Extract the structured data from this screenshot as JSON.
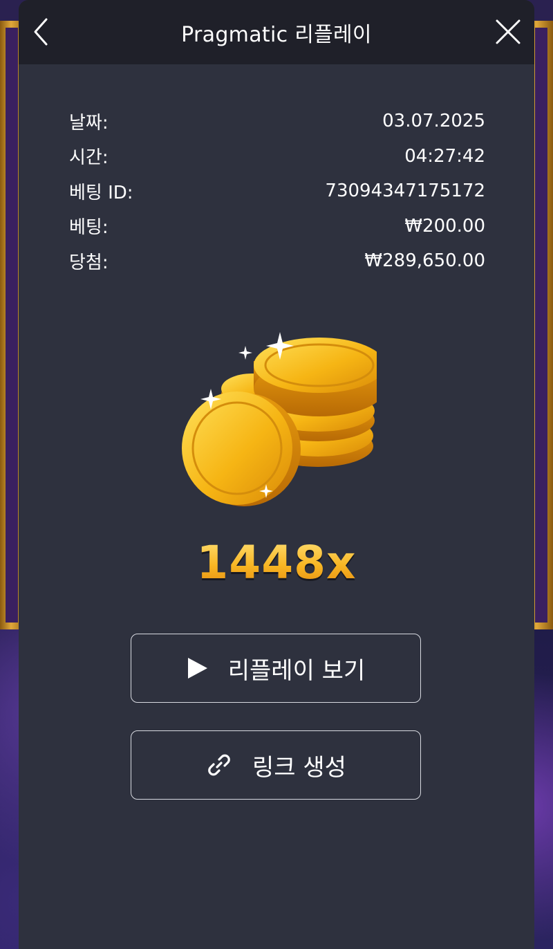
{
  "header": {
    "title": "Pragmatic 리플레이",
    "back_icon": "chevron-left-icon",
    "close_icon": "close-icon"
  },
  "details": [
    {
      "label": "날짜:",
      "value": "03.07.2025"
    },
    {
      "label": "시간:",
      "value": "04:27:42"
    },
    {
      "label": "베팅 ID:",
      "value": "73094347175172"
    },
    {
      "label": "베팅:",
      "value": "₩200.00"
    },
    {
      "label": "당첨:",
      "value": "₩289,650.00"
    }
  ],
  "result": {
    "image_icon": "gold-coins-icon",
    "multiplier": "1448x"
  },
  "buttons": {
    "replay_label": "리플레이 보기",
    "replay_icon": "play-icon",
    "link_label": "링크 생성",
    "link_icon": "link-icon"
  },
  "colors": {
    "modal_bg": "#2e313e",
    "header_bg": "#1f2029",
    "text": "#ffffff",
    "gold": "#f6b21d"
  }
}
